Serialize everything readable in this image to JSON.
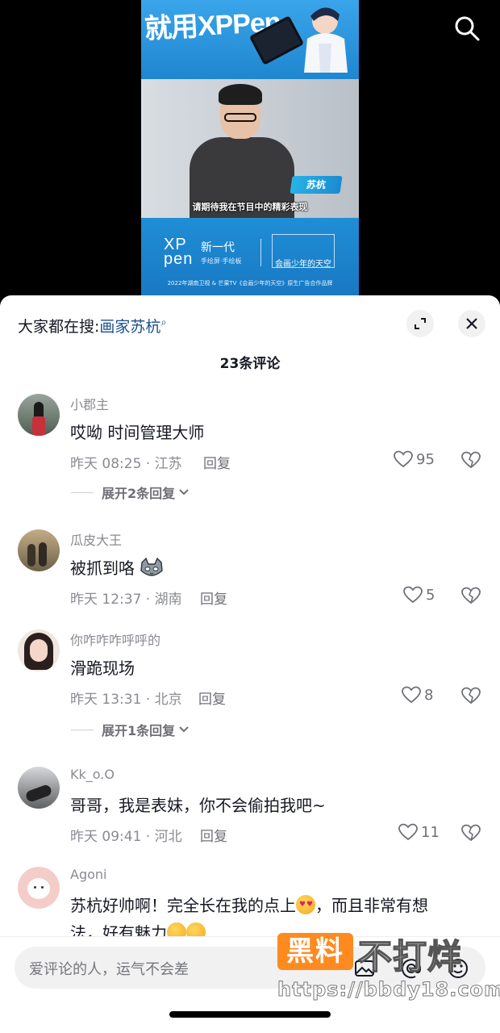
{
  "video": {
    "banner_text": "就用XPPen",
    "name_tag": "苏杭",
    "subtitle": "请期待我在节目中的精彩表现",
    "logo_xp": "XP\npen",
    "logo_new": "新一代",
    "logo_sub": "手绘屏·手绘板",
    "show_title": "会画少年的天空",
    "ad_footer": "2022年湖南卫视 & 芒果TV《会画少年的天空》原生广告合作品牌"
  },
  "header": {
    "hot_search_prefix": "大家都在搜:",
    "hot_search_keyword": "画家苏杭",
    "comment_count": "23条评论"
  },
  "comments": [
    {
      "name": "小郡主",
      "text": "哎呦 时间管理大师",
      "meta": "昨天 08:25 · 江苏",
      "reply_label": "回复",
      "likes": "95",
      "expand": "展开2条回复",
      "avatar_color": "#5a6b5e"
    },
    {
      "name": "瓜皮大王",
      "text": "被抓到咯",
      "meta": "昨天 12:37 · 湖南",
      "reply_label": "回复",
      "likes": "5",
      "avatar_color": "#8a7a5c"
    },
    {
      "name": "你咋咋咋呼呼的",
      "text": "滑跪现场",
      "meta": "昨天 13:31 · 北京",
      "reply_label": "回复",
      "likes": "8",
      "expand": "展开1条回复",
      "avatar_color": "#e7ddd6"
    },
    {
      "name": "Kk_o.O",
      "text": "哥哥，我是表妹，你不会偷拍我吧~",
      "meta": "昨天 09:41 · 河北",
      "reply_label": "回复",
      "likes": "11",
      "avatar_color": "#6d6f72"
    },
    {
      "name": "Agoni",
      "text_part1": "苏杭好帅啊！完全长在我的点上",
      "text_part2": "，而且非常有想",
      "text_line2": "法，好有魅力",
      "avatar_color": "#f4c7c3"
    }
  ],
  "input": {
    "placeholder": "爱评论的人，运气不会差"
  },
  "watermark": {
    "box": "黑料",
    "text": "不打烊",
    "url": "https://bbdy18.com"
  }
}
